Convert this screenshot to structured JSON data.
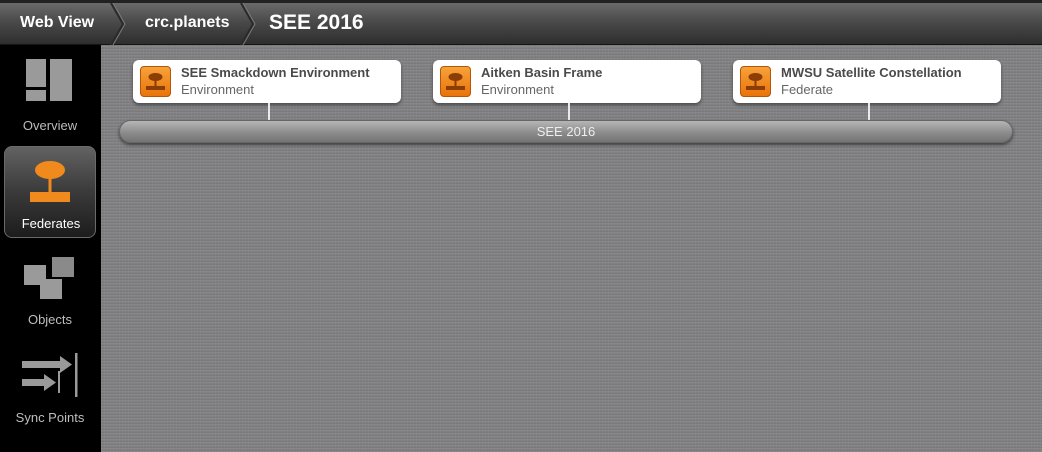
{
  "breadcrumb": {
    "items": [
      {
        "label": "Web View"
      },
      {
        "label": "crc.planets"
      },
      {
        "label": "SEE 2016"
      }
    ]
  },
  "sidebar": {
    "items": [
      {
        "label": "Overview",
        "icon": "overview-icon",
        "active": false
      },
      {
        "label": "Federates",
        "icon": "federate-icon",
        "active": true
      },
      {
        "label": "Objects",
        "icon": "objects-icon",
        "active": false
      },
      {
        "label": "Sync Points",
        "icon": "sync-points-icon",
        "active": false
      }
    ]
  },
  "federates": [
    {
      "name": "SEE Smackdown Environment",
      "type": "Environment"
    },
    {
      "name": "Aitken Basin Frame",
      "type": "Environment"
    },
    {
      "name": "MWSU Satellite Constellation",
      "type": "Federate"
    }
  ],
  "federation": {
    "label": "SEE 2016"
  },
  "colors": {
    "accent": "#f08a1c",
    "active_nav": "#4a4a4a",
    "canvas": "#7f7f82"
  }
}
